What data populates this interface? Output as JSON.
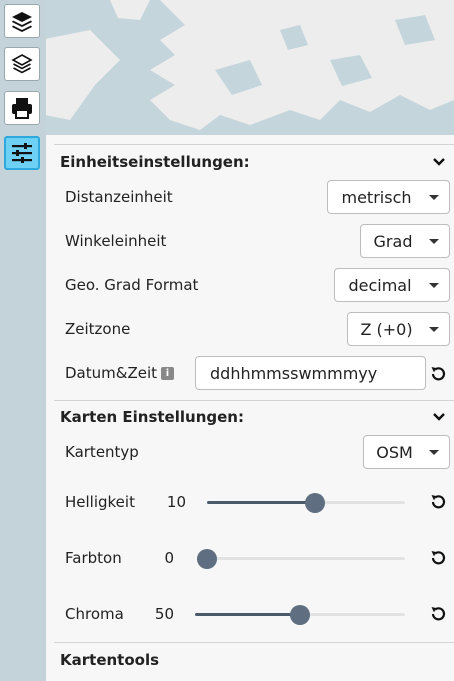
{
  "toolbar": {
    "buttons": [
      {
        "name": "layers-icon"
      },
      {
        "name": "layers-outline-icon"
      },
      {
        "name": "print-icon"
      },
      {
        "name": "sliders-icon",
        "active": true
      }
    ]
  },
  "unit_settings": {
    "title": "Einheitseinstellungen:",
    "distance": {
      "label": "Distanzeinheit",
      "value": "metrisch"
    },
    "angle": {
      "label": "Winkeleinheit",
      "value": "Grad"
    },
    "geo_format": {
      "label": "Geo. Grad Format",
      "value": "decimal"
    },
    "timezone": {
      "label": "Zeitzone",
      "value": "Z (+0)"
    },
    "datetime": {
      "label": "Datum&Zeit",
      "info_icon": "i",
      "value": "ddhhmmsswmmmyy"
    }
  },
  "map_settings": {
    "title": "Karten Einstellungen:",
    "map_type": {
      "label": "Kartentyp",
      "value": "OSM"
    },
    "brightness": {
      "label": "Helligkeit",
      "value": "10",
      "min": -100,
      "max": 100,
      "level": 10
    },
    "hue": {
      "label": "Farbton",
      "value": "0",
      "min": 0,
      "max": 360,
      "level": 0
    },
    "chroma": {
      "label": "Chroma",
      "value": "50",
      "min": 0,
      "max": 100,
      "level": 50
    }
  },
  "map_tools": {
    "title": "Kartentools"
  },
  "colors": {
    "active_tool": "#6fd0f5",
    "panel_bg": "#f7f7f7",
    "slider": "#5f6e80"
  }
}
